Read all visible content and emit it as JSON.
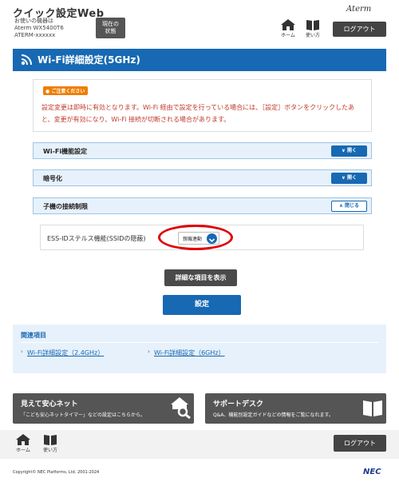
{
  "header": {
    "app_title": "クイック設定Web",
    "device_label": "お使いの機器は",
    "model": "Aterm WX5400T6",
    "device_id": "ATERM-xxxxxx",
    "status_button": [
      "現在の",
      "状態"
    ],
    "brand": "Aterm",
    "home_label": "ホーム",
    "manual_label": "使い方",
    "logout_label": "ログアウト"
  },
  "page": {
    "title": "Wi-Fi詳細設定(5GHz)"
  },
  "notice": {
    "badge": "ご注意ください",
    "text": "設定変更は即時に有効となります。Wi-Fi 経由で設定を行っている場合には、［設定］ボタンをクリックしたあと、変更が有効になり、Wi-Fi 接続が切断される場合があります。"
  },
  "sections": [
    {
      "title": "Wi-Fi機能設定",
      "button": "開く"
    },
    {
      "title": "暗号化",
      "button": "開く"
    },
    {
      "title": "子機の接続制限",
      "button": "閉じる"
    }
  ],
  "stealth": {
    "label": "ESS-IDステルス機能(SSIDの隠蔽)",
    "value": "親機連動"
  },
  "buttons": {
    "show_detail": "詳細な項目を表示",
    "apply": "設定"
  },
  "related": {
    "title": "関連項目",
    "links": [
      "Wi-Fi詳細設定（2.4GHz）",
      "Wi-Fi詳細設定（6GHz）"
    ]
  },
  "banners": [
    {
      "title": "見えて安心ネット",
      "sub": "「こども安心ネットタイマー」などの設定はこちらから。"
    },
    {
      "title": "サポートデスク",
      "sub": "Q&A、機能別設定ガイドなどの情報をご覧になれます。"
    }
  ],
  "footer": {
    "home_label": "ホーム",
    "manual_label": "使い方",
    "logout_label": "ログアウト",
    "copyright": "Copyright© NEC Platforms, Ltd. 2001-2024",
    "nec": "NEC"
  },
  "colors": {
    "accent": "#1769b3",
    "notice_text": "#c0392b",
    "highlight": "#e00000"
  }
}
